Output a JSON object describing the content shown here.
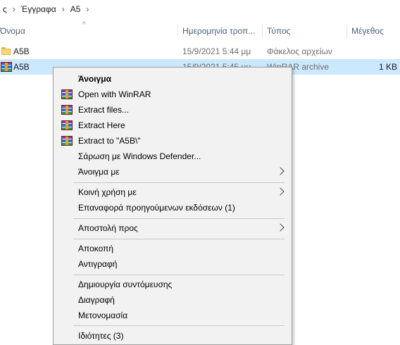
{
  "breadcrumb": {
    "items": [
      "ς",
      "Έγγραφα",
      "A5"
    ],
    "separator": "›"
  },
  "columns": {
    "name": "Όνομα",
    "date": "Ημερομηνία τροπ...",
    "type": "Τύπος",
    "size": "Μέγεθος"
  },
  "files": [
    {
      "name": "A5B",
      "date": "15/9/2021 5:44 μμ",
      "type": "Φάκελος αρχείων",
      "size": "",
      "icon": "folder-icon",
      "selected": false
    },
    {
      "name": "A5B",
      "date": "15/9/2021 5:45 μμ",
      "type": "WinRAR archive",
      "size": "1 KB",
      "icon": "winrar-icon",
      "selected": true
    }
  ],
  "context_menu": {
    "items": [
      {
        "label": "Άνοιγμα",
        "bold": true
      },
      {
        "label": "Open with WinRAR",
        "icon": "winrar-icon"
      },
      {
        "label": "Extract files...",
        "icon": "winrar-icon"
      },
      {
        "label": "Extract Here",
        "icon": "winrar-icon"
      },
      {
        "label": "Extract to \"A5B\\\"",
        "icon": "winrar-icon"
      },
      {
        "label": "Σάρωση με Windows Defender..."
      },
      {
        "label": "Άνοιγμα με",
        "submenu": true
      },
      {
        "label": "Κοινή χρήση με",
        "submenu": true
      },
      {
        "label": "Επαναφορά προηγούμενων εκδόσεων (1)"
      },
      {
        "label": "Αποστολή προς",
        "submenu": true
      },
      {
        "label": "Αποκοπή"
      },
      {
        "label": "Αντιγραφή"
      },
      {
        "label": "Δημιουργία συντόμευσης"
      },
      {
        "label": "Διαγραφή"
      },
      {
        "label": "Μετονομασία"
      },
      {
        "label": "Ιδιότητες (3)"
      }
    ]
  },
  "colors": {
    "selection": "#cce8ff",
    "header_text": "#4c607a",
    "menu_background": "#f2f2f2"
  }
}
